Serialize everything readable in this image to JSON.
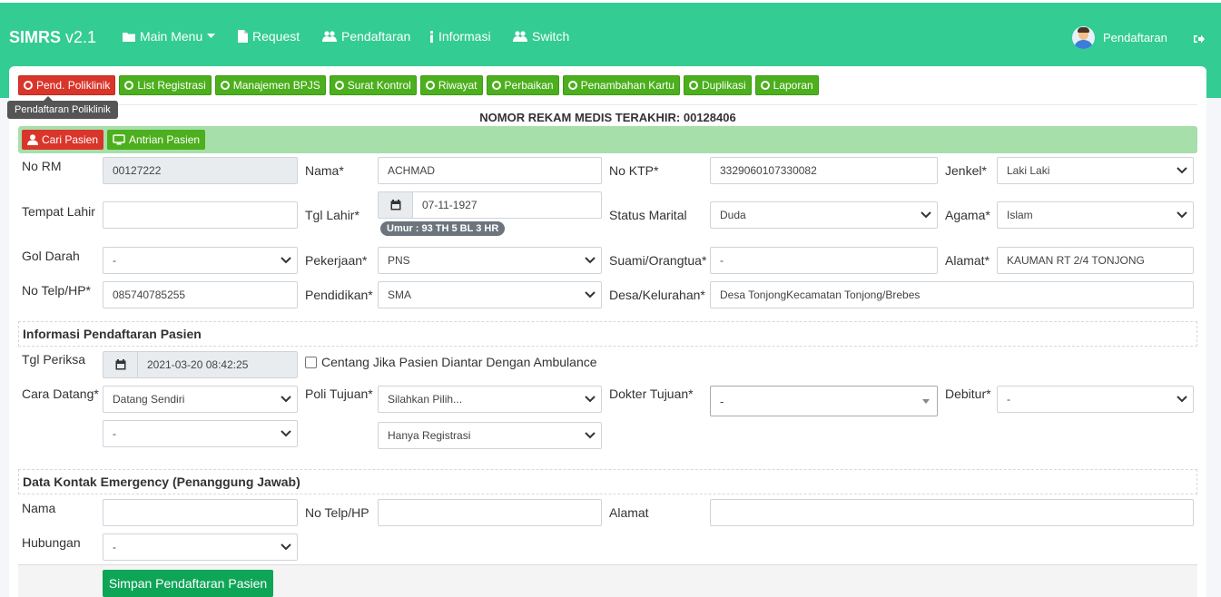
{
  "app": {
    "brand": "SIMRS",
    "version": "v2.1"
  },
  "nav": {
    "main_menu": "Main Menu",
    "request": "Request",
    "pendaftaran": "Pendaftaran",
    "informasi": "Informasi",
    "switch": "Switch",
    "user": "Pendaftaran"
  },
  "tabs": [
    {
      "label": "Pend. Poliklinik",
      "active": true
    },
    {
      "label": "List Registrasi"
    },
    {
      "label": "Manajemen BPJS"
    },
    {
      "label": "Surat Kontrol"
    },
    {
      "label": "Riwayat"
    },
    {
      "label": "Perbaikan"
    },
    {
      "label": "Penambahan Kartu"
    },
    {
      "label": "Duplikasi"
    },
    {
      "label": "Laporan"
    }
  ],
  "tooltip": "Pendaftaran Poliklinik",
  "rm_title": "NOMOR REKAM MEDIS TERAKHIR: 00128406",
  "actions": {
    "cari_pasien": "Cari Pasien",
    "antrian_pasien": "Antrian Pasien"
  },
  "patient": {
    "no_rm": {
      "label": "No RM",
      "value": "00127222"
    },
    "nama": {
      "label": "Nama*",
      "value": "ACHMAD"
    },
    "no_ktp": {
      "label": "No KTP*",
      "value": "3329060107330082"
    },
    "jenkel": {
      "label": "Jenkel*",
      "value": "Laki Laki"
    },
    "tempat_lahir": {
      "label": "Tempat Lahir",
      "value": ""
    },
    "tgl_lahir": {
      "label": "Tgl Lahir*",
      "value": "07-11-1927",
      "umur": "Umur : 93 TH 5 BL 3 HR"
    },
    "status_marital": {
      "label": "Status Marital",
      "value": "Duda"
    },
    "agama": {
      "label": "Agama*",
      "value": "Islam"
    },
    "gol_darah": {
      "label": "Gol Darah",
      "value": "-"
    },
    "pekerjaan": {
      "label": "Pekerjaan*",
      "value": "PNS"
    },
    "suami_orangtua": {
      "label": "Suami/Orangtua*",
      "value": "-"
    },
    "alamat": {
      "label": "Alamat*",
      "value": "KAUMAN RT 2/4 TONJONG"
    },
    "no_telp": {
      "label": "No Telp/HP*",
      "value": "085740785255"
    },
    "pendidikan": {
      "label": "Pendidikan*",
      "value": "SMA"
    },
    "desa": {
      "label": "Desa/Kelurahan*",
      "value": "Desa TonjongKecamatan Tonjong/Brebes"
    }
  },
  "registration": {
    "section_title": "Informasi Pendaftaran Pasien",
    "tgl_periksa": {
      "label": "Tgl Periksa",
      "value": "2021-03-20 08:42:25"
    },
    "ambulance_label": "Centang Jika Pasien Diantar Dengan Ambulance",
    "cara_datang": {
      "label": "Cara Datang*",
      "value": "Datang Sendiri",
      "value2": "-"
    },
    "poli_tujuan": {
      "label": "Poli Tujuan*",
      "value": "Silahkan Pilih...",
      "value2": "Hanya Registrasi"
    },
    "dokter_tujuan": {
      "label": "Dokter Tujuan*",
      "value": "-"
    },
    "debitur": {
      "label": "Debitur*",
      "value": "-"
    }
  },
  "emergency": {
    "section_title": "Data Kontak Emergency (Penanggung Jawab)",
    "nama": {
      "label": "Nama",
      "value": ""
    },
    "no_telp": {
      "label": "No Telp/HP",
      "value": ""
    },
    "alamat": {
      "label": "Alamat",
      "value": ""
    },
    "hubungan": {
      "label": "Hubungan",
      "value": "-"
    }
  },
  "save_button": "Simpan Pendaftaran Pasien",
  "colors": {
    "header": "#33cc93",
    "tab": "#4caf1d",
    "tab_active": "#d9352b",
    "action_bar": "#a6dfaa",
    "save": "#0fa557"
  }
}
